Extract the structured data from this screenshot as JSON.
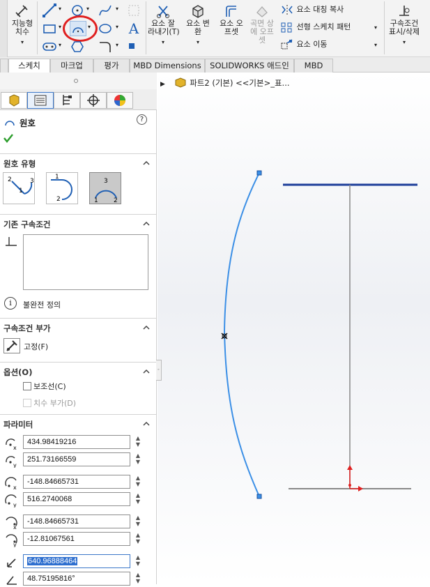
{
  "ribbon": {
    "smart_dim": "지능형\n치수",
    "trim": "요소 잘\n라내기(T)",
    "convert": "요소 변\n환",
    "offset": "요소 오\n프셋",
    "surface_offset": "곡면 상\n에 오프\n셋",
    "mirror": "요소 대칭 복사",
    "linear_pattern": "선형 스케치 패턴",
    "move": "요소 이동",
    "relations": "구속조건\n표시/삭제"
  },
  "tabs": [
    "스케치",
    "마크업",
    "평가",
    "MBD Dimensions",
    "SOLIDWORKS 애드인",
    "MBD"
  ],
  "active_tab": "스케치",
  "tree": {
    "part": "파트2 (기본) <<기본>_표..."
  },
  "pm": {
    "title": "원호",
    "arc_type_header": "원호 유형",
    "existing_rel_header": "기존 구속조건",
    "status": "불완전 정의",
    "add_rel_header": "구속조건 부가",
    "fix_label": "고정(F)",
    "options_header": "옵션(O)",
    "construction_label": "보조선(C)",
    "add_dim_label": "치수 부가(D)",
    "params_header": "파라미터",
    "params": [
      "434.98419216",
      "251.73166559",
      "-148.84665731",
      "516.2740068",
      "-148.84665731",
      "-12.81067561",
      "640.96888464",
      "48.75195816°"
    ]
  },
  "colors": {
    "accent": "#1f6fc4",
    "arc": "#3b8fe6",
    "check": "#2d9e2d",
    "highlight": "#e02020"
  }
}
